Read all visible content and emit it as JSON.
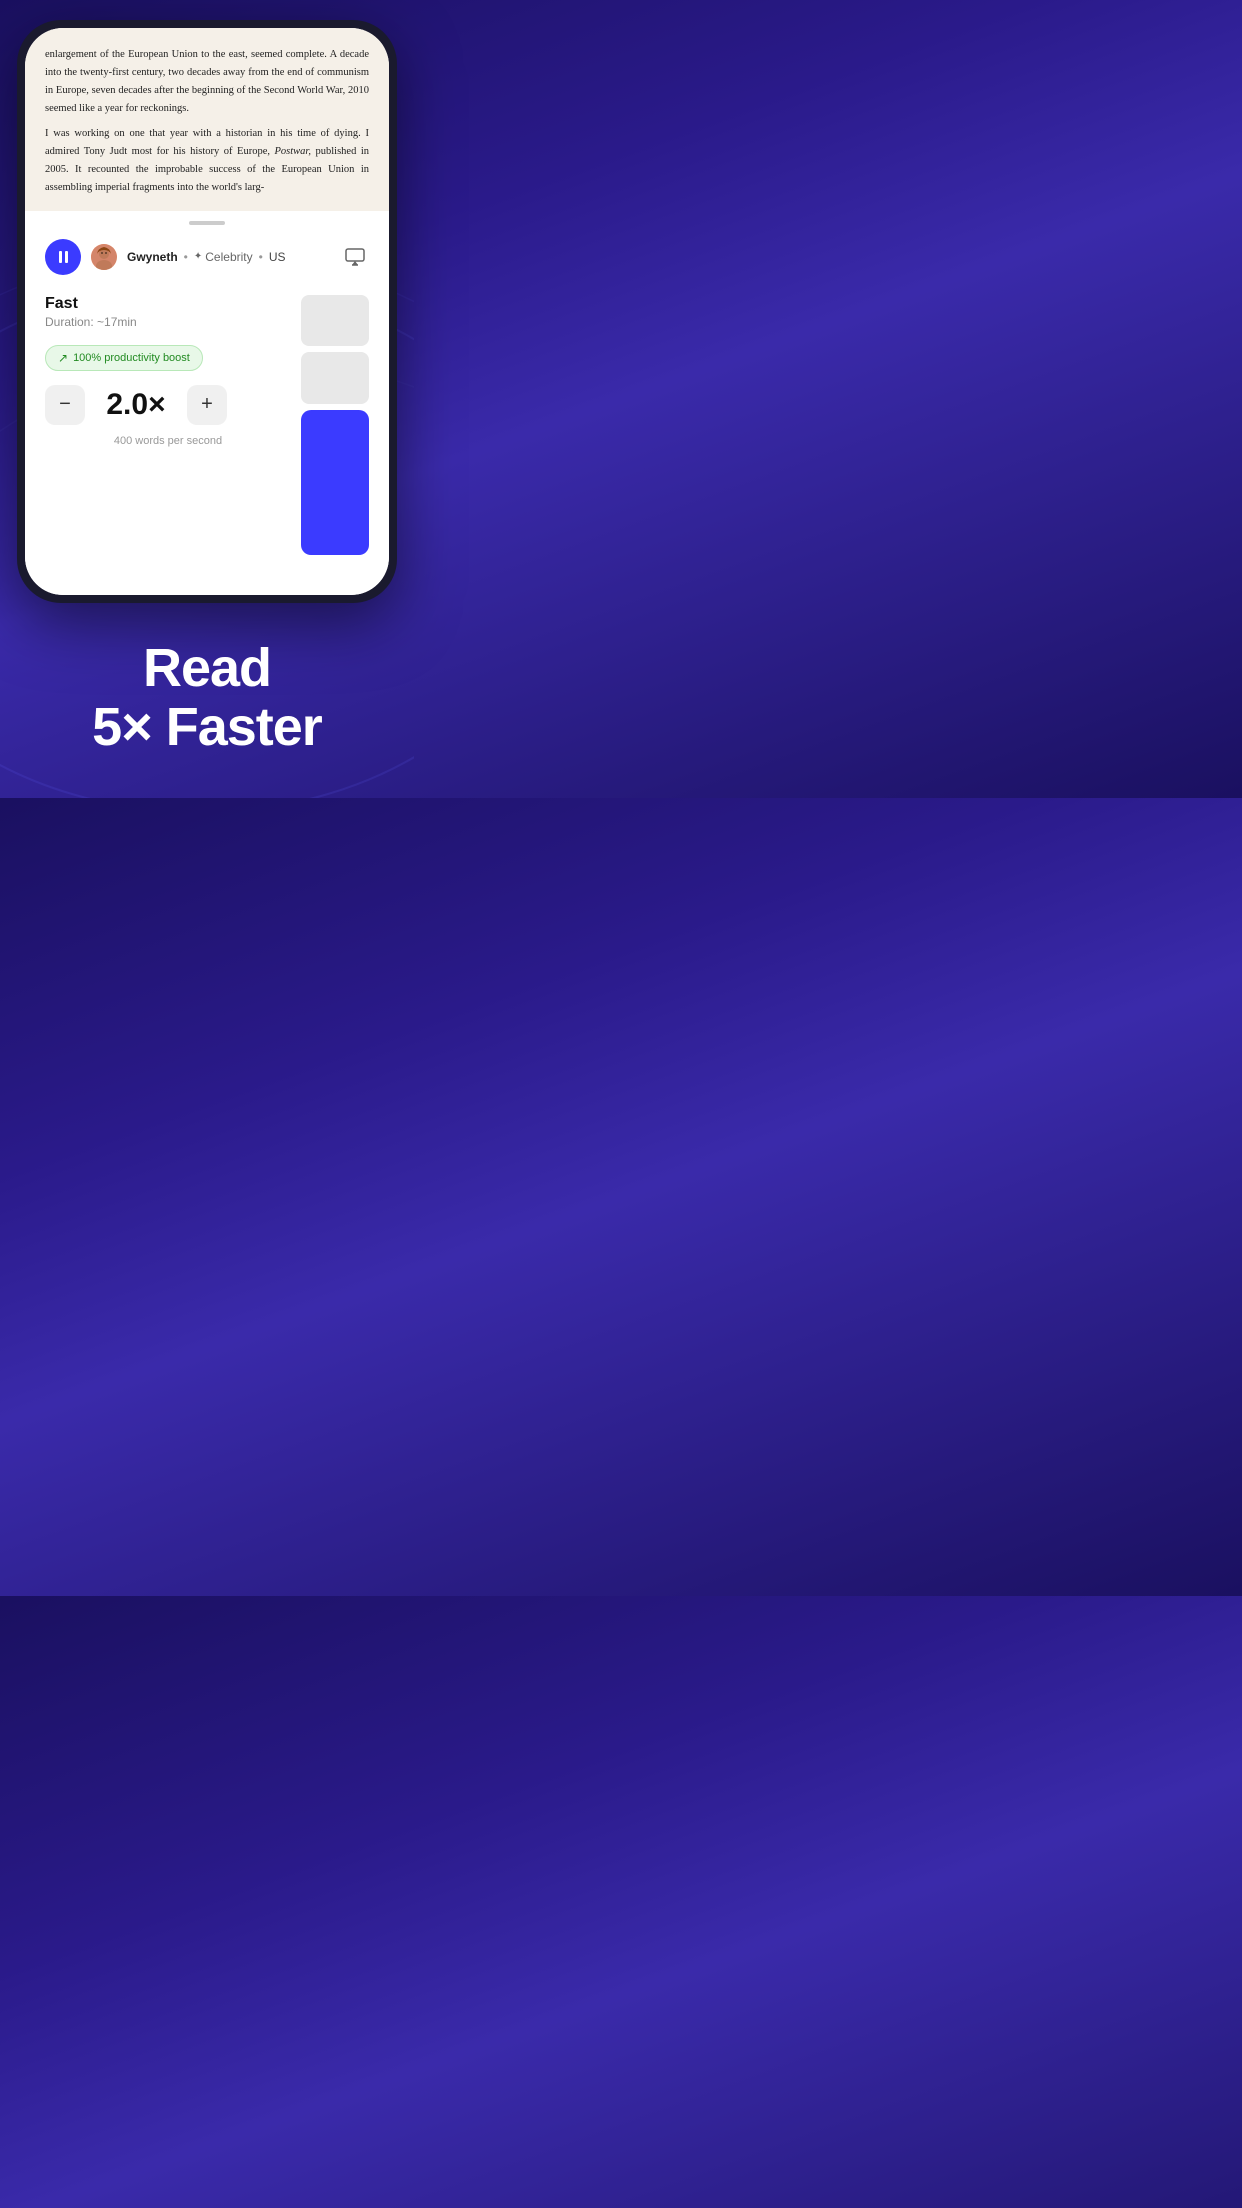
{
  "background": {
    "gradient_start": "#1a1060",
    "gradient_end": "#3a2aaa"
  },
  "book_text": {
    "paragraph1": "enlargement of the European Union to the east, seemed complete. A decade into the twenty-first century, two decades away from the end of communism in Europe, seven decades after the beginning of the Second World War, 2010 seemed like a year for reckonings.",
    "paragraph2": "I was working on one that year with a historian in his time of dying. I admired Tony Judt most for his history of Europe,",
    "book_title": "Postwar,",
    "paragraph2_cont": "published in 2005. It recounted the improbable success of the European Union in assembling imperial fragments into the world's larg-"
  },
  "voice_bar": {
    "pause_label": "pause",
    "voice_name": "Gwyneth",
    "separator": "•",
    "voice_type": "Celebrity",
    "region": "US",
    "star_icon": "✦"
  },
  "speed": {
    "label": "Fast",
    "duration": "Duration: ~17min",
    "productivity_badge": "100% productivity boost",
    "arrow_icon": "↗",
    "value": "2.0×",
    "words_per_second": "400 words per second"
  },
  "controls": {
    "minus_label": "−",
    "plus_label": "+"
  },
  "slider": {
    "segments": [
      {
        "type": "inactive",
        "label": "top segment"
      },
      {
        "type": "inactive",
        "label": "mid segment"
      },
      {
        "type": "active",
        "label": "active segment"
      }
    ]
  },
  "marketing": {
    "line1": "Read",
    "line2": "5× Faster"
  }
}
